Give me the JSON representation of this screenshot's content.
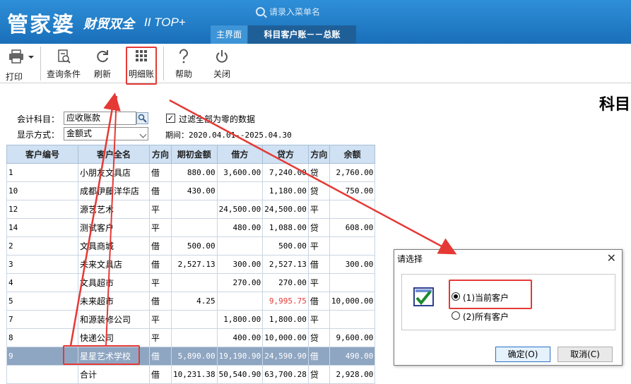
{
  "header": {
    "logo_main": "管家婆",
    "logo_sub": "财贸双全",
    "logo_version": "II TOP+",
    "search_placeholder": "请录入菜单名",
    "tabs": [
      {
        "label": "主界面",
        "active": false
      },
      {
        "label": "科目客户账－－总账",
        "active": true
      }
    ]
  },
  "toolbar": {
    "print": "打印",
    "query": "查询条件",
    "refresh": "刷新",
    "detail": "明细账",
    "help": "帮助",
    "close": "关闭"
  },
  "page_title": "科目",
  "filters": {
    "account_label": "会计科目：",
    "account_value": "应收账款",
    "display_label": "显示方式：",
    "display_value": "金额式",
    "filter_zero_label": "过滤全部为零的数据",
    "filter_zero_checked": true,
    "period": "期间：2020.04.01--2025.04.30"
  },
  "table": {
    "columns": [
      "客户编号",
      "客户全名",
      "方向",
      "期初金额",
      "借方",
      "贷方",
      "方向",
      "余额"
    ],
    "rows": [
      [
        "1",
        "小朋友文具店",
        "借",
        "880.00",
        "3,600.00",
        "7,240.00",
        "贷",
        "2,760.00"
      ],
      [
        "10",
        "成都伊藤洋华店",
        "借",
        "430.00",
        "",
        "1,180.00",
        "贷",
        "750.00"
      ],
      [
        "12",
        "源艺艺术",
        "平",
        "",
        "24,500.00",
        "24,500.00",
        "平",
        ""
      ],
      [
        "14",
        "测试客户",
        "平",
        "",
        "480.00",
        "1,088.00",
        "贷",
        "608.00"
      ],
      [
        "2",
        "文具商城",
        "借",
        "500.00",
        "",
        "500.00",
        "平",
        ""
      ],
      [
        "3",
        "未来文具店",
        "借",
        "2,527.13",
        "300.00",
        "2,527.13",
        "借",
        "300.00"
      ],
      [
        "4",
        "文具超市",
        "平",
        "",
        "270.00",
        "270.00",
        "平",
        ""
      ],
      [
        "5",
        "未来超市",
        "借",
        "4.25",
        "",
        "9,995.75",
        "借",
        "10,000.00"
      ],
      [
        "7",
        "和源装修公司",
        "平",
        "",
        "1,800.00",
        "1,800.00",
        "平",
        ""
      ],
      [
        "8",
        "快递公司",
        "平",
        "",
        "400.00",
        "10,000.00",
        "贷",
        "9,600.00"
      ],
      [
        "9",
        "星星艺术学校",
        "借",
        "5,890.00",
        "19,190.90",
        "24,590.90",
        "借",
        "490.00"
      ]
    ],
    "total": [
      "",
      "合计",
      "借",
      "10,231.38",
      "50,540.90",
      "63,700.28",
      "贷",
      "2,928.00"
    ],
    "selected_row": 10,
    "negative_cell": {
      "row": 7,
      "col": 5
    }
  },
  "dialog": {
    "title": "请选择",
    "option_current": "(1)当前客户",
    "option_all": "(2)所有客户",
    "selected": "current",
    "ok": "确定(O)",
    "cancel": "取消(C)"
  },
  "colors": {
    "header_blue": "#1a6fb9",
    "highlight_red": "#e53935",
    "selected_row": "#8fa6c2",
    "table_header": "#cfe1f3"
  }
}
